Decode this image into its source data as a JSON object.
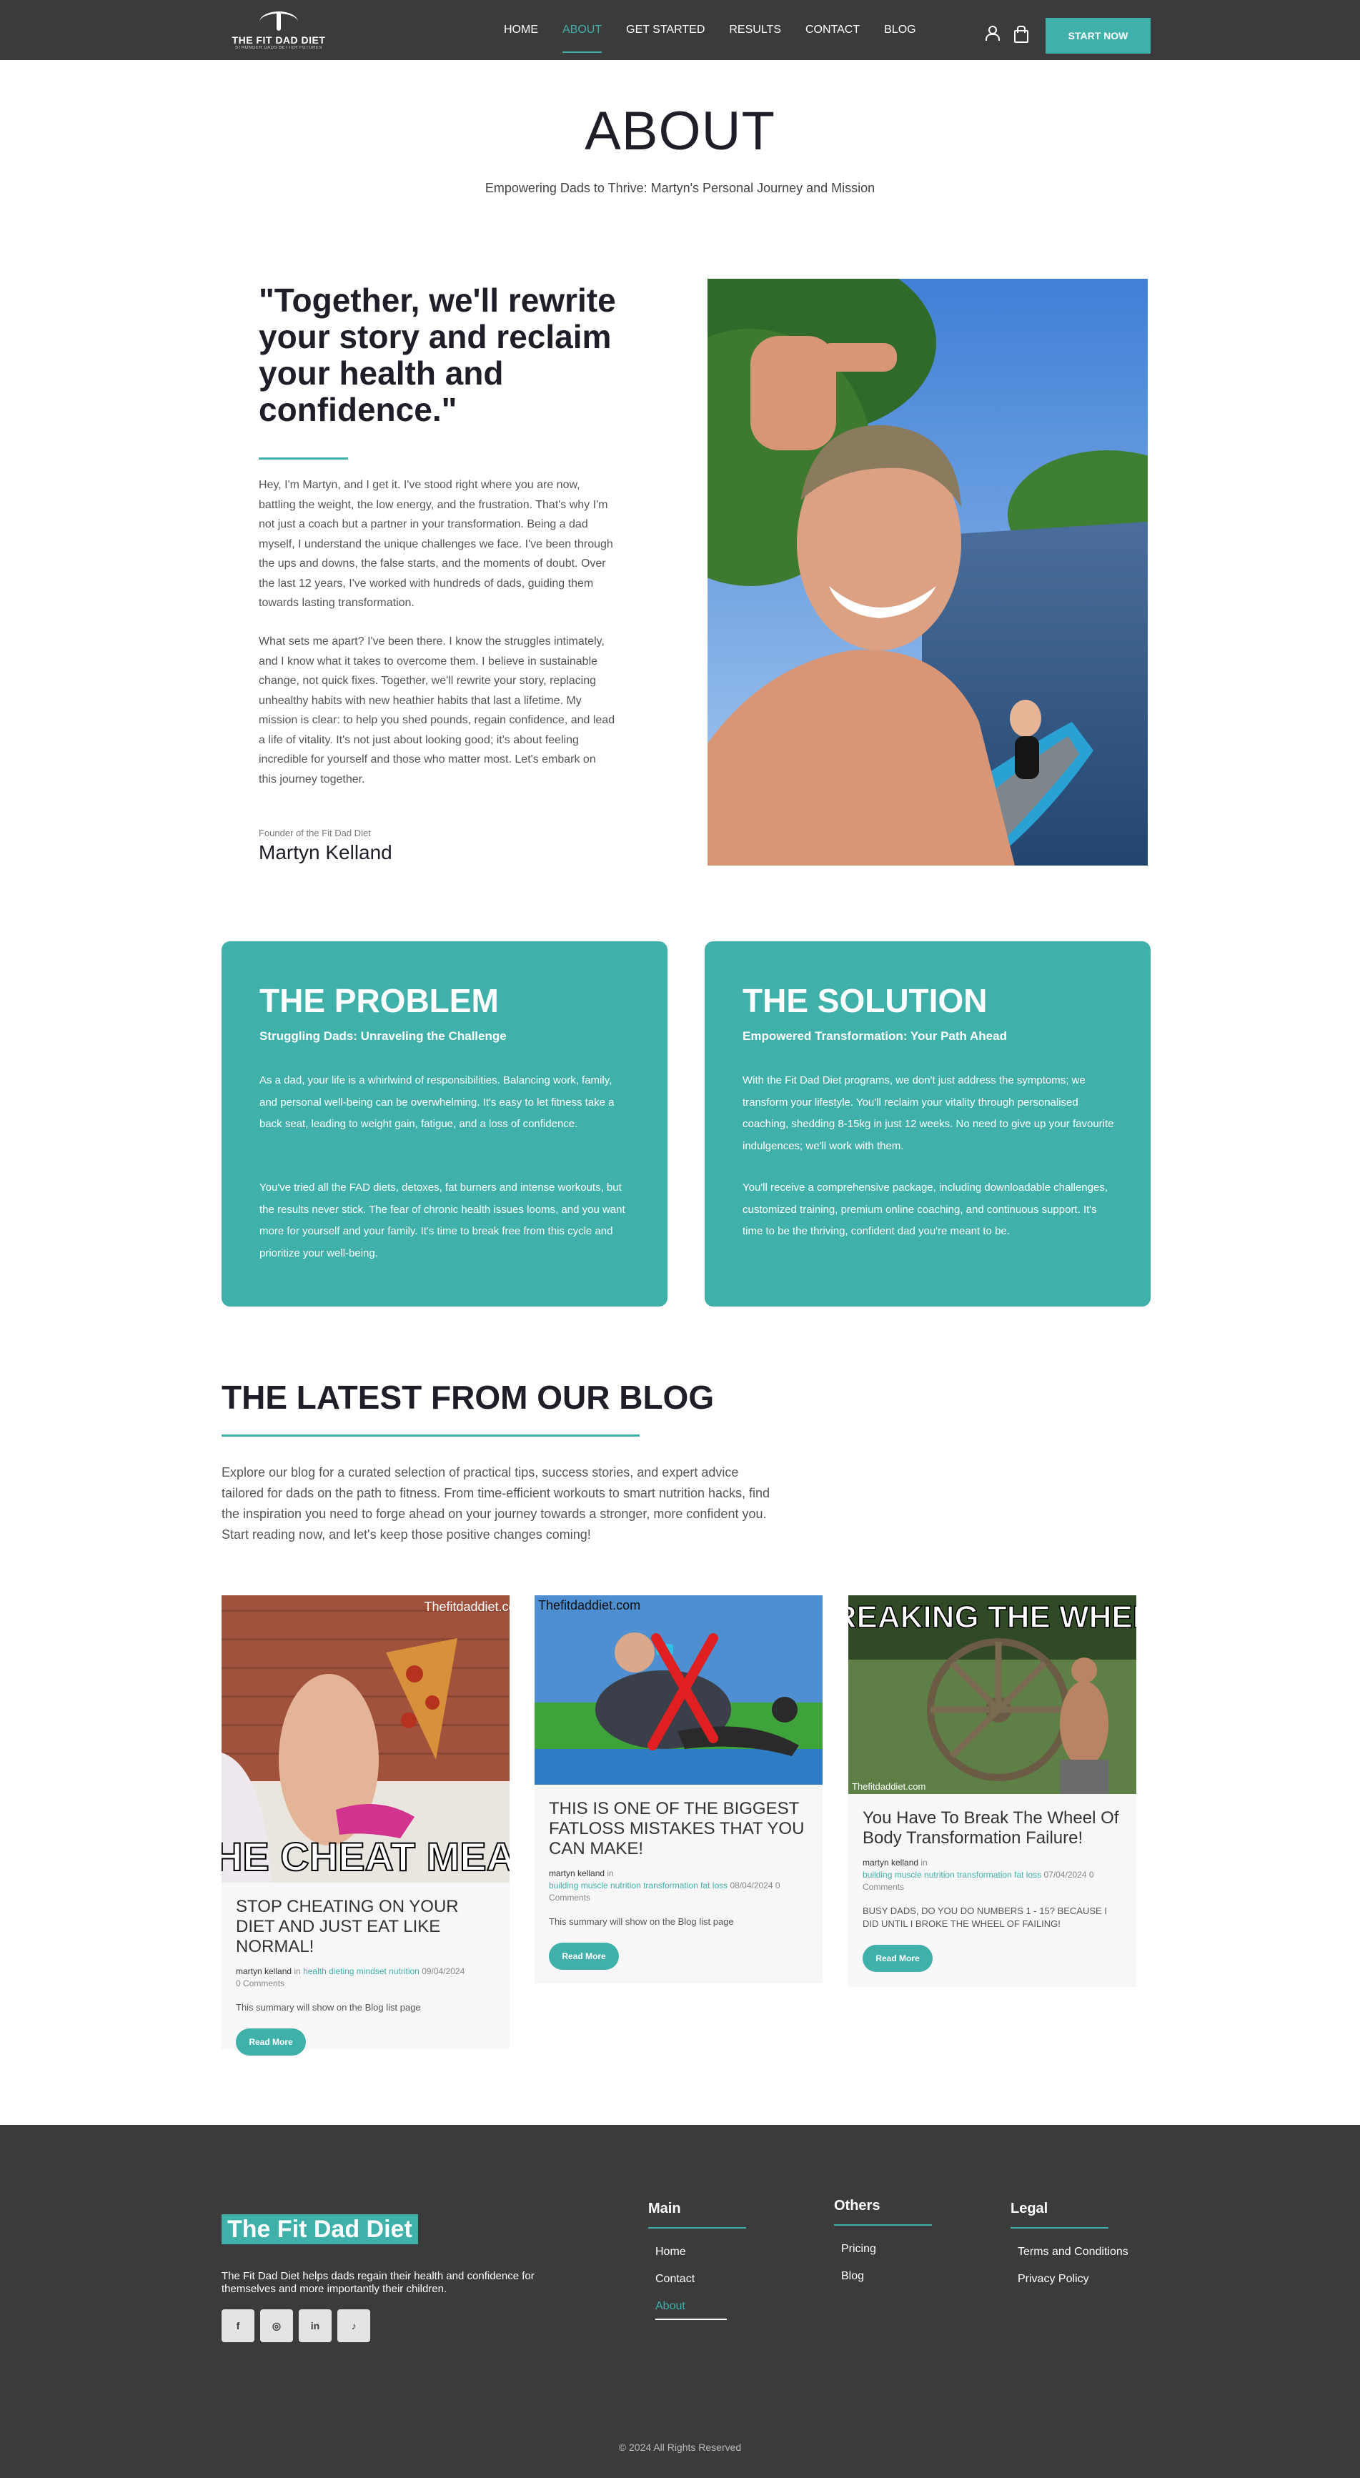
{
  "header": {
    "logo_text": "THE FIT DAD DIET",
    "logo_tagline": "STRONGER DADS BETTER FUTURES",
    "nav": [
      {
        "label": "HOME"
      },
      {
        "label": "ABOUT"
      },
      {
        "label": "GET STARTED"
      },
      {
        "label": "RESULTS"
      },
      {
        "label": "CONTACT"
      },
      {
        "label": "BLOG"
      }
    ],
    "active_nav": "ABOUT",
    "cta_label": "START NOW",
    "icons": [
      "user-icon",
      "shopping-bag-icon"
    ]
  },
  "about": {
    "title": "ABOUT",
    "subtitle": "Empowering Dads to Thrive: Martyn's Personal Journey and Mission",
    "quote": "\"Together, we'll rewrite your story and reclaim your health and confidence.\"",
    "bio_1": "Hey, I'm Martyn, and I get it. I've stood right where you are now, battling the weight, the low energy, and the frustration. That's why I'm not just a coach but a partner in your transformation. Being a dad myself, I understand the unique challenges we face. I've been through the ups and downs, the false starts, and the moments of doubt. Over the last 12 years, I've worked with hundreds of dads, guiding them towards lasting transformation.",
    "bio_2": "What sets me apart? I've been there. I know the struggles intimately, and I know what it takes to overcome them. I believe in sustainable change, not quick fixes. Together, we'll rewrite your story, replacing unhealthy habits with new heathier habits that last a lifetime. My mission is clear: to help you shed pounds, regain confidence, and lead a life of vitality. It's not just about looking good; it's about feeling incredible for yourself and those who matter most. Let's embark on this journey together.",
    "founder_label": "Founder of the Fit Dad Diet",
    "founder_name": "Martyn Kelland"
  },
  "problem": {
    "title": "THE PROBLEM",
    "subtitle": "Struggling Dads: Unraveling the Challenge",
    "p1": "As a dad, your life is a whirlwind of responsibilities. Balancing work, family, and personal well-being can be overwhelming. It's easy to let fitness take a back seat, leading to weight gain, fatigue, and a loss of confidence.",
    "p2": "You've tried all the FAD diets, detoxes, fat burners and intense workouts, but the results never stick. The fear of chronic health issues looms, and you want more for yourself and your family. It's time to break free from this cycle and prioritize your well-being."
  },
  "solution": {
    "title": "THE SOLUTION",
    "subtitle": "Empowered Transformation: Your Path Ahead",
    "p1": "With the Fit Dad Diet programs, we don't just address the symptoms; we transform your lifestyle. You'll reclaim your vitality through personalised coaching, shedding 8-15kg in just 12 weeks. No need to give up your favourite indulgences; we'll work with them.",
    "p2": "You'll receive a comprehensive package, including downloadable challenges, customized training, premium online coaching, and continuous support. It's time to be the thriving, confident dad you're meant to be."
  },
  "blog": {
    "title": "THE LATEST FROM OUR BLOG",
    "intro": "Explore our blog for a curated selection of practical tips, success stories, and expert advice tailored for dads on the path to fitness. From time-efficient workouts to smart nutrition hacks, find the inspiration you need to forge ahead on your journey towards a stronger, more confident you. Start reading now, and let's keep those positive changes coming!",
    "read_more": "Read More",
    "posts": [
      {
        "image_watermark": "Thefitdaddiet.com",
        "image_caption": "THE CHEAT MEAL",
        "title": "STOP CHEATING ON YOUR DIET AND JUST EAT LIKE NORMAL!",
        "author": "martyn kelland",
        "in": "in",
        "categories": "health dieting mindset nutrition",
        "date": "09/04/2024",
        "comments": "0 Comments",
        "summary": "This summary will show on the Blog list page"
      },
      {
        "image_watermark": "Thefitdaddiet.com",
        "image_caption": "",
        "title": "THIS IS ONE OF THE BIGGEST FATLOSS MISTAKES THAT YOU CAN MAKE!",
        "author": "martyn kelland",
        "in": "in",
        "categories": "building muscle nutrition transformation fat loss",
        "date": "08/04/2024",
        "comments": "0 Comments",
        "summary": "This summary will show on the Blog list page"
      },
      {
        "image_watermark": "Thefitdaddiet.com",
        "image_caption": "BREAKING THE WHEEL",
        "title": "You Have To Break The Wheel Of Body Transformation Failure!",
        "author": "martyn kelland",
        "in": "in",
        "categories": "building muscle nutrition transformation fat loss",
        "date": "07/04/2024",
        "comments": "0 Comments",
        "summary": "BUSY DADS, DO YOU DO NUMBERS 1 - 15? BECAUSE I DID UNTIL I BROKE THE WHEEL OF FAILING!"
      }
    ]
  },
  "footer": {
    "brand": "The Fit Dad Diet",
    "description": "The Fit Dad Diet helps dads regain their health and confidence for themselves and more importantly their children.",
    "socials": [
      {
        "icon": "facebook-icon",
        "glyph": "f"
      },
      {
        "icon": "instagram-icon",
        "glyph": "◎"
      },
      {
        "icon": "linkedin-icon",
        "glyph": "in"
      },
      {
        "icon": "tiktok-icon",
        "glyph": "♪"
      }
    ],
    "main": {
      "title": "Main",
      "links": [
        "Home",
        "Contact",
        "About"
      ]
    },
    "others": {
      "title": "Others",
      "links": [
        "Pricing",
        "Blog"
      ]
    },
    "legal": {
      "title": "Legal",
      "links": [
        "Terms and Conditions",
        "Privacy Policy"
      ]
    },
    "copyright": "© 2024 All Rights Reserved"
  },
  "colors": {
    "accent": "#3fb0aa",
    "header_bg": "#3b3b3b",
    "footer_bg": "#3b3b3b",
    "heading": "#1e1e28"
  }
}
